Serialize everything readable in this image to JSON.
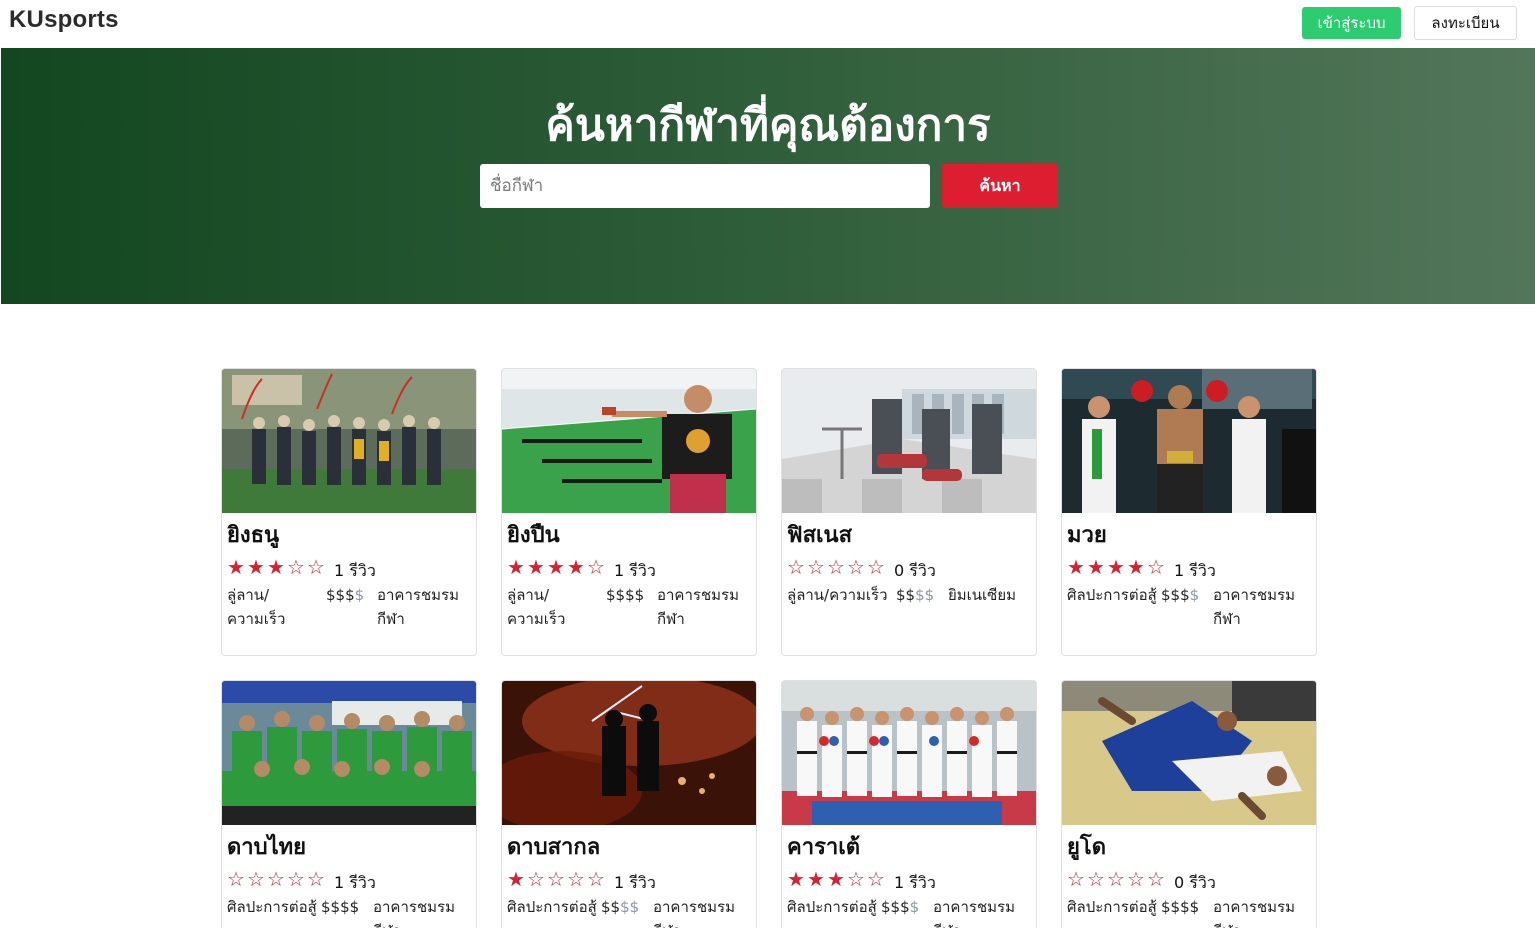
{
  "navbar": {
    "brand": "KUsports",
    "login_label": "เข้าสู่ระบบ",
    "register_label": "ลงทะเบียน",
    "login_color": "#2ecc71"
  },
  "hero": {
    "title": "ค้นหากีฬาที่คุณต้องการ",
    "search_placeholder": "ชื่อกีฬา",
    "search_button": "ค้นหา",
    "accent_color": "#dc1e30"
  },
  "sports": [
    {
      "name": "ยิงธนู",
      "rating": 3,
      "reviews": "1 รีวิว",
      "category": "ลู่ลาน/ความเร็ว",
      "price_on": "$$$",
      "price_off": "$",
      "location": "อาคารชมรมกีฬา",
      "image_icon": "archery-photo"
    },
    {
      "name": "ยิงปืน",
      "rating": 4,
      "reviews": "1 รีวิว",
      "category": "ลู่ลาน/ความเร็ว",
      "price_on": "$$$$",
      "price_off": "",
      "location": "อาคารชมรมกีฬา",
      "image_icon": "shooting-photo"
    },
    {
      "name": "ฟิสเนส",
      "rating": 0,
      "reviews": "0 รีวิว",
      "category": "ลู่ลาน/ความเร็ว",
      "price_on": "$$",
      "price_off": "$$",
      "location": "ยิมเนเซียม",
      "image_icon": "fitness-photo"
    },
    {
      "name": "มวย",
      "rating": 4,
      "reviews": "1 รีวิว",
      "category": "ศิลปะการต่อสู้",
      "price_on": "$$$",
      "price_off": "$",
      "location": "อาคารชมรมกีฬา",
      "image_icon": "boxing-photo"
    },
    {
      "name": "ดาบไทย",
      "rating": 0,
      "reviews": "1 รีวิว",
      "category": "ศิลปะการต่อสู้",
      "price_on": "$$$$",
      "price_off": "",
      "location": "อาคารชมรมกีฬา",
      "image_icon": "thai-sword-photo"
    },
    {
      "name": "ดาบสากล",
      "rating": 1,
      "reviews": "1 รีวิว",
      "category": "ศิลปะการต่อสู้",
      "price_on": "$$",
      "price_off": "$$",
      "location": "อาคารชมรมกีฬา",
      "image_icon": "fencing-photo"
    },
    {
      "name": "คาราเต้",
      "rating": 3,
      "reviews": "1 รีวิว",
      "category": "ศิลปะการต่อสู้",
      "price_on": "$$$",
      "price_off": "$",
      "location": "อาคารชมรมกีฬา",
      "image_icon": "karate-photo"
    },
    {
      "name": "ยูโด",
      "rating": 0,
      "reviews": "0 รีวิว",
      "category": "ศิลปะการต่อสู้",
      "price_on": "$$$$",
      "price_off": "",
      "location": "อาคารชมรมกีฬา",
      "image_icon": "judo-photo"
    }
  ]
}
